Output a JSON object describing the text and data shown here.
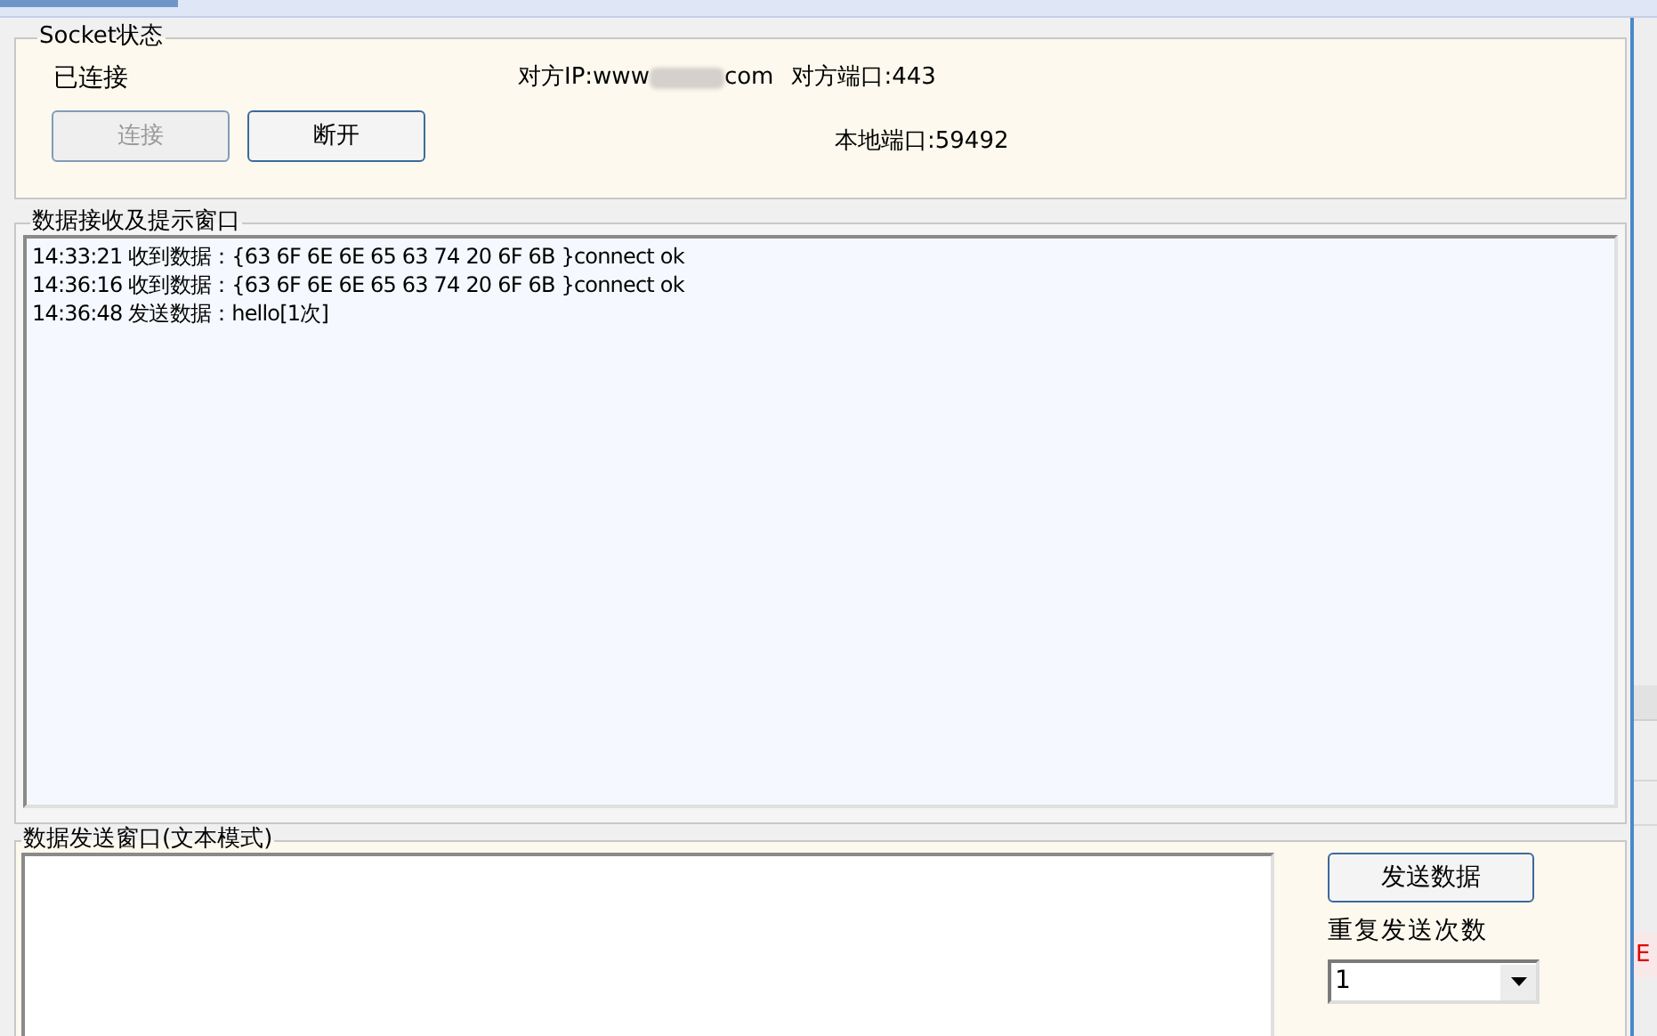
{
  "socket_group": {
    "title": "Socket状态",
    "status": "已连接",
    "remote_ip_label": "对方IP:www",
    "remote_ip_suffix": "com",
    "remote_port": "对方端口:443",
    "local_port": "本地端口:59492",
    "buttons": [
      {
        "label": "连接",
        "disabled": true
      },
      {
        "label": "断开",
        "disabled": false
      }
    ]
  },
  "receive_group": {
    "title": "数据接收及提示窗口",
    "lines": [
      "14:33:21 收到数据：{63 6F 6E 6E 65 63 74 20 6F 6B }connect ok",
      "14:36:16 收到数据：{63 6F 6E 6E 65 63 74 20 6F 6B }connect ok",
      "14:36:48 发送数据：hello[1次]"
    ]
  },
  "send_group": {
    "title": "数据发送窗口(文本模式)",
    "send_button": "发送数据",
    "repeat_label": "重复发送次数",
    "repeat_value": "1"
  },
  "side_text": "E"
}
